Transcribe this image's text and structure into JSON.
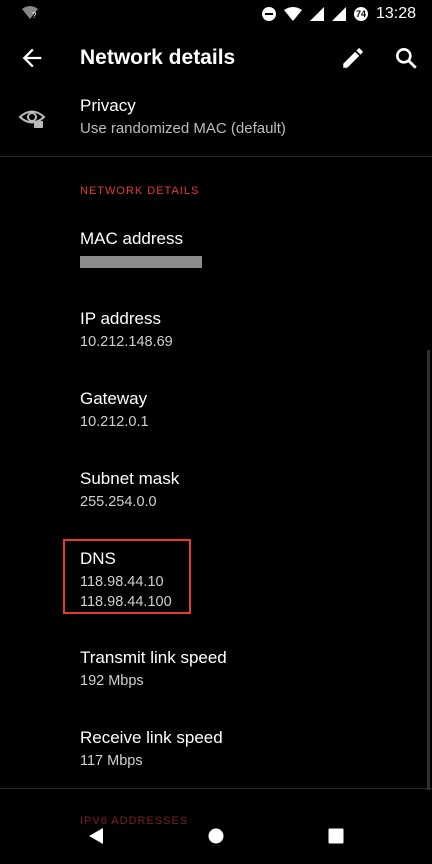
{
  "status_bar": {
    "time": "13:28",
    "battery_badge": "74",
    "icons": [
      "wifi-question-icon",
      "do-not-disturb-icon",
      "wifi-icon",
      "signal-icon",
      "signal-icon",
      "battery-icon"
    ]
  },
  "app_bar": {
    "title": "Network details",
    "icons": [
      "back-arrow-icon",
      "edit-pencil-icon",
      "search-icon"
    ]
  },
  "privacy": {
    "title": "Privacy",
    "subtitle": "Use randomized MAC (default)",
    "icon": "eye-lock-icon"
  },
  "section": {
    "header": "NETWORK DETAILS"
  },
  "items": [
    {
      "label": "MAC address",
      "value": ""
    },
    {
      "label": "IP address",
      "value": "10.212.148.69"
    },
    {
      "label": "Gateway",
      "value": "10.212.0.1"
    },
    {
      "label": "Subnet mask",
      "value": "255.254.0.0"
    },
    {
      "label": "DNS",
      "value": "118.98.44.10",
      "value2": "118.98.44.100"
    },
    {
      "label": "Transmit link speed",
      "value": "192 Mbps"
    },
    {
      "label": "Receive link speed",
      "value": "117 Mbps"
    }
  ],
  "ipv6_header": "IPV6 ADDRESSES",
  "nav_bar": {
    "icons": [
      "back-triangle-icon",
      "home-circle-icon",
      "recents-square-icon"
    ]
  },
  "colors": {
    "accent": "#e53935",
    "highlight_box": "#e53935",
    "background": "#000000"
  }
}
